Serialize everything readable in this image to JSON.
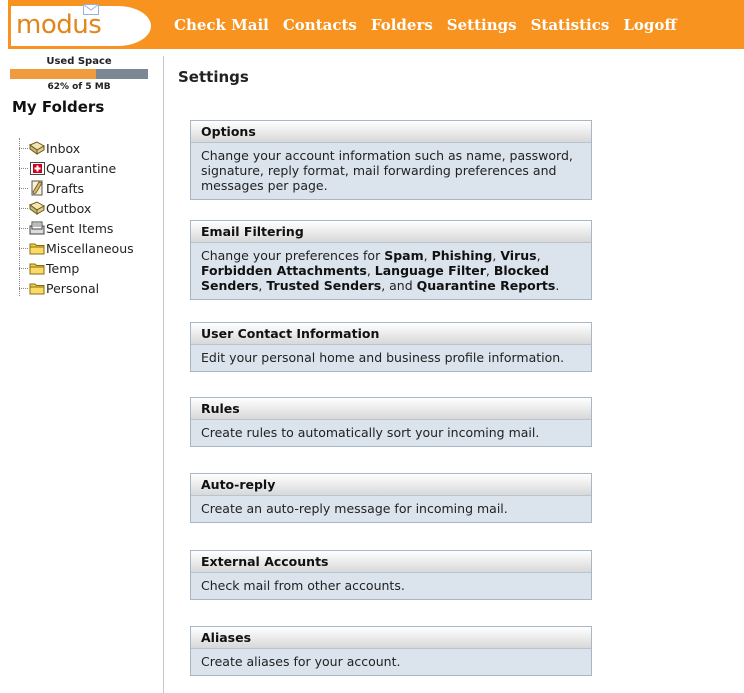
{
  "logo": {
    "text": "modus"
  },
  "nav": [
    "Check Mail",
    "Contacts",
    "Folders",
    "Settings",
    "Statistics",
    "Logoff"
  ],
  "sidebar": {
    "used_space_label": "Used Space",
    "used_percent": 62,
    "used_text": "62% of 5 MB",
    "my_folders": "My Folders",
    "folders": [
      {
        "label": "Inbox",
        "icon": "inbox-icon"
      },
      {
        "label": "Quarantine",
        "icon": "quarantine-icon"
      },
      {
        "label": "Drafts",
        "icon": "drafts-icon"
      },
      {
        "label": "Outbox",
        "icon": "outbox-icon"
      },
      {
        "label": "Sent Items",
        "icon": "sent-items-icon"
      },
      {
        "label": "Miscellaneous",
        "icon": "folder-icon"
      },
      {
        "label": "Temp",
        "icon": "folder-icon"
      },
      {
        "label": "Personal",
        "icon": "folder-icon"
      }
    ]
  },
  "main": {
    "title": "Settings",
    "sections": [
      {
        "title": "Options",
        "desc": "Change your account information such as name, password, signature, reply format, mail forwarding preferences and messages per page."
      },
      {
        "title": "Email Filtering",
        "desc_intro": "Change your preferences for ",
        "items": [
          "Spam",
          "Phishing",
          "Virus",
          "Forbidden Attachments",
          "Language Filter",
          "Blocked Senders",
          "Trusted Senders",
          "Quarantine Reports"
        ],
        "sep": ", ",
        "last_sep": ", and ",
        "end": "."
      },
      {
        "title": "User Contact Information",
        "desc": "Edit your personal home and business profile information."
      },
      {
        "title": "Rules",
        "desc": "Create rules to automatically sort your incoming mail."
      },
      {
        "title": "Auto-reply",
        "desc": "Create an auto-reply message for incoming mail."
      },
      {
        "title": "External Accounts",
        "desc": "Check mail from other accounts."
      },
      {
        "title": "Aliases",
        "desc": "Create aliases for your account."
      }
    ]
  },
  "colors": {
    "header": "#f7931e",
    "card_bg": "#dbe3ec",
    "card_border": "#a9b6c4"
  }
}
